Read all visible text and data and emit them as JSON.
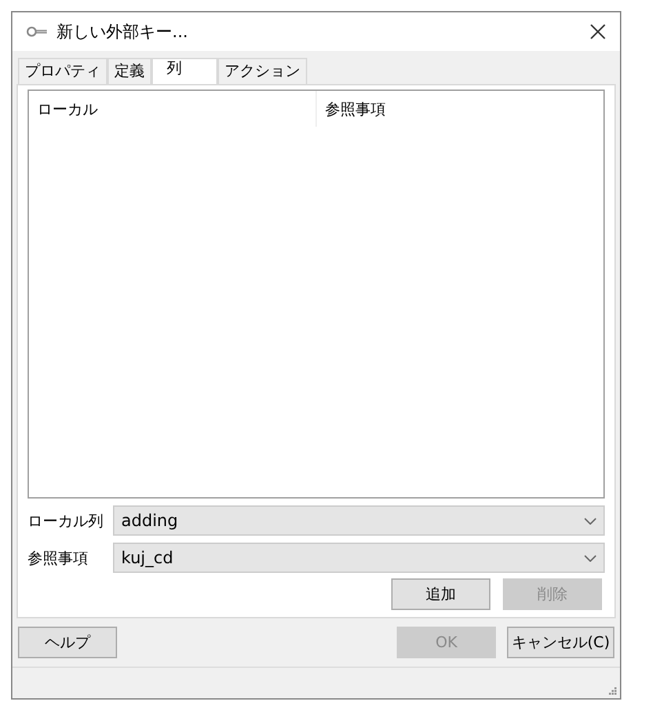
{
  "window": {
    "title": "新しい外部キー..."
  },
  "tabs": [
    {
      "label": "プロパティ",
      "selected": false
    },
    {
      "label": "定義",
      "selected": false
    },
    {
      "label": "列",
      "selected": true
    },
    {
      "label": "アクション",
      "selected": false
    }
  ],
  "table": {
    "columns": [
      "ローカル",
      "参照事項"
    ]
  },
  "fields": [
    {
      "label": "ローカル列",
      "value": "adding"
    },
    {
      "label": "参照事項",
      "value": "kuj_cd"
    }
  ],
  "panel_buttons": [
    {
      "label": "追加",
      "disabled": false
    },
    {
      "label": "削除",
      "disabled": true
    }
  ],
  "footer": {
    "left": [
      {
        "label": "ヘルプ",
        "disabled": false
      }
    ],
    "right": [
      {
        "label": "OK",
        "disabled": true
      },
      {
        "label": "キャンセル(C)",
        "disabled": false
      }
    ]
  }
}
